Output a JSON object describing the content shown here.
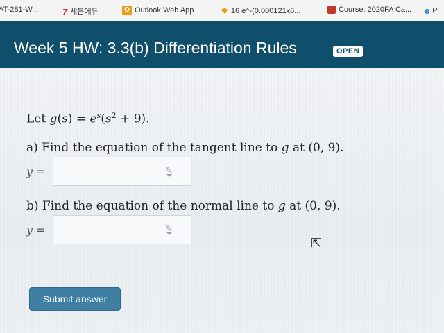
{
  "bookmarks": [
    {
      "icon": "none",
      "label": "AT-281-W..."
    },
    {
      "icon": "seven-icon",
      "label": "세븐에듀"
    },
    {
      "icon": "outlook-icon",
      "label": "Outlook Web App"
    },
    {
      "icon": "sun-icon",
      "label": "16 e^-(0.000121x6..."
    },
    {
      "icon": "course-icon",
      "label": "Course: 2020FA Ca..."
    },
    {
      "icon": "edge-icon",
      "label": "P"
    }
  ],
  "header": {
    "title": "Week 5 HW: 3.3(b) Differentiation Rules",
    "badge": "OPEN"
  },
  "problem": {
    "intro": "Let g(s) = e^s(s^2 + 9).",
    "part_a": "a) Find the equation of the tangent line to g at (0, 9).",
    "part_b": "b) Find the equation of the normal line to g at (0, 9).",
    "answer_label": "y ="
  },
  "answer_a": {
    "value": ""
  },
  "answer_b": {
    "value": ""
  },
  "submit": {
    "label": "Submit answer"
  }
}
